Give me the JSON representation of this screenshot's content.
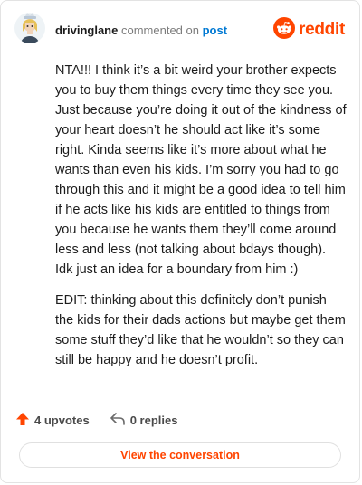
{
  "header": {
    "username": "drivinglane",
    "commented_on": "commented on",
    "post_link": "post",
    "brand": "reddit"
  },
  "comment": {
    "paragraphs": [
      "NTA!!! I think it’s a bit weird your brother expects you to buy them things every time they see you. Just because you’re doing it out of the kindness of your heart doesn’t he should act like it’s some right. Kinda seems like it’s more about what he wants than even his kids. I’m sorry you had to go through this and it might be a good idea to tell him if he acts like his kids are entitled to things from you because he wants them they’ll come around less and less (not talking about bdays though). Idk just an idea for a boundary from him :)",
      "EDIT: thinking about this definitely don’t punish the kids for their dads actions but maybe get them some stuff they’d like that he wouldn’t so they can still be happy and he doesn’t profit."
    ]
  },
  "footer": {
    "upvotes": "4 upvotes",
    "replies": "0 replies",
    "view_button": "View the conversation"
  },
  "colors": {
    "brand": "#ff4500",
    "link": "#0079d3"
  },
  "icons": {
    "avatar": "avatar",
    "logo": "reddit-snoo-icon",
    "upvote": "upvote-arrow-icon",
    "reply": "reply-arrow-icon"
  }
}
